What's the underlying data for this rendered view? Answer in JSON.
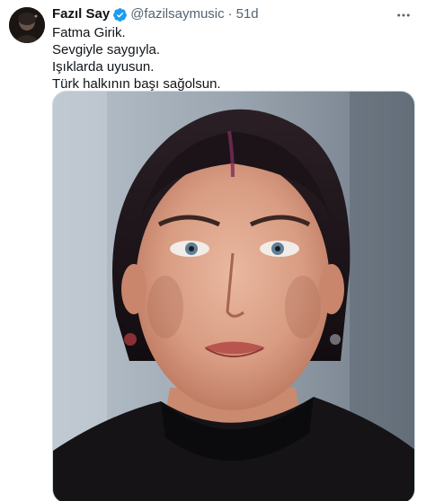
{
  "tweet": {
    "author_name": "Fazıl Say",
    "handle": "@fazilsaymusic",
    "separator": "·",
    "timestamp": "51d",
    "lines": [
      "Fatma Girik.",
      "Sevgiyle saygıyla.",
      "Işıklarda uyusun.",
      "Türk halkının başı sağolsun."
    ],
    "icons": {
      "verified": "verified-badge-icon",
      "more": "more-options-icon"
    },
    "colors": {
      "verified": "#1d9bf0",
      "secondary_text": "#536471",
      "primary_text": "#0f1419"
    }
  }
}
